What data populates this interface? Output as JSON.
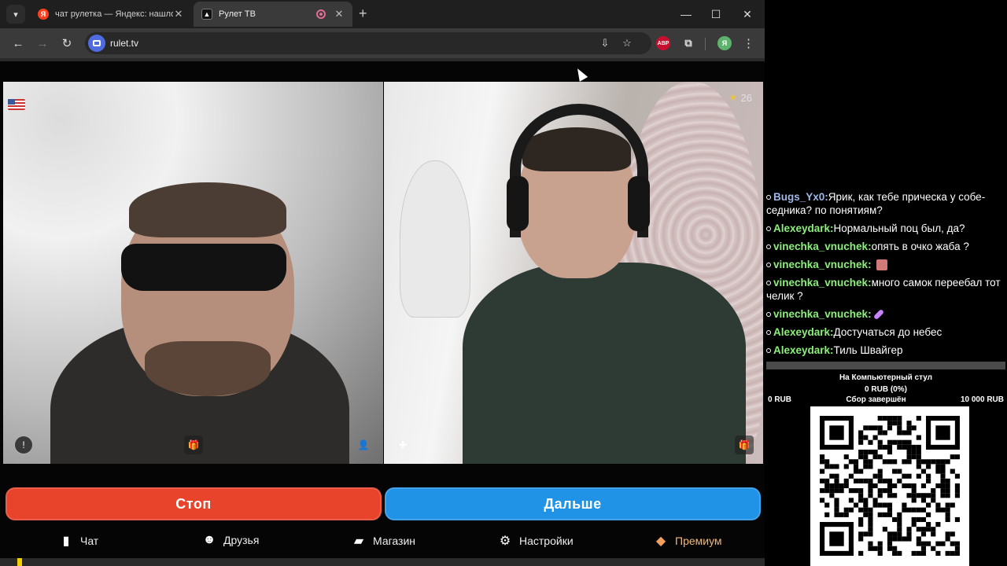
{
  "browser": {
    "tabs": [
      {
        "title": "чат рулетка — Яндекс: нашлос",
        "favicon": "Я"
      },
      {
        "title": "Рулет ТВ"
      }
    ],
    "url": "rulet.tv",
    "abp_label": "ABP",
    "profile_initial": "Я"
  },
  "video": {
    "stranger_stars": "26"
  },
  "actions": {
    "stop_label": "Стоп",
    "next_label": "Дальше"
  },
  "nav": {
    "chat": "Чат",
    "friends": "Друзья",
    "shop": "Магазин",
    "settings": "Настройки",
    "premium": "Премиум"
  },
  "stream_chat": [
    {
      "user": "Bugs_Yx0:",
      "text": "Ярик, как тебе прическа у собе-седника? по понятиям?",
      "color": "#9fb8e8"
    },
    {
      "user": "Alexeydark:",
      "text": "Нормальный поц был, да?",
      "color": "#8cf07a"
    },
    {
      "user": "vinechka_vnuchek:",
      "text": "опять в очко жаба ?",
      "color": "#8cf07a"
    },
    {
      "user": "vinechka_vnuchek:",
      "text": "",
      "color": "#8cf07a"
    },
    {
      "user": "vinechka_vnuchek:",
      "text": "много самок переебал тот челик ?",
      "color": "#8cf07a"
    },
    {
      "user": "vinechka_vnuchek:",
      "text": "",
      "color": "#8cf07a"
    },
    {
      "user": "Alexeydark:",
      "text": "Достучаться до небес",
      "color": "#8cf07a"
    },
    {
      "user": "Alexeydark:",
      "text": "Тиль Швайгер",
      "color": "#8cf07a"
    }
  ],
  "donation": {
    "title": "На Компьютерный стул",
    "raised": "0 RUB (0%)",
    "min": "0 RUB",
    "status": "Сбор завершён",
    "goal": "10 000 RUB",
    "progress_percent": 0
  },
  "colors": {
    "stop": "#e8432b",
    "next": "#2193e6",
    "premium": "#f2b878"
  }
}
